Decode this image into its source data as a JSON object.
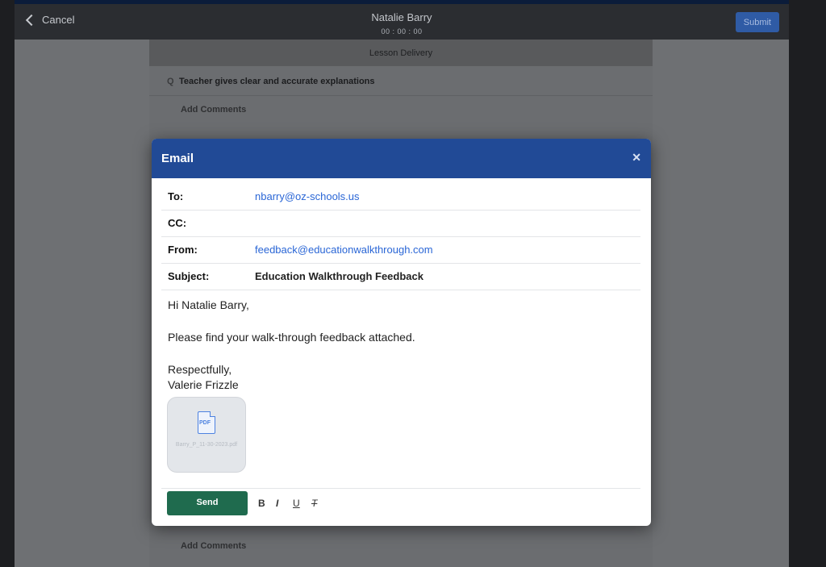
{
  "topbar": {
    "cancel_label": "Cancel",
    "title": "Natalie Barry",
    "timer": "00 : 00 : 00",
    "submit_label": "Submit"
  },
  "background": {
    "section_title": "Lesson Delivery",
    "question_marker": "Q",
    "question_text": "Teacher gives clear and accurate explanations",
    "add_comments_label": "Add Comments"
  },
  "modal": {
    "title": "Email",
    "close_icon": "close-icon",
    "fields": {
      "to_label": "To:",
      "to_value": "nbarry@oz-schools.us",
      "cc_label": "CC:",
      "cc_value": "",
      "from_label": "From:",
      "from_value": "feedback@educationwalkthrough.com",
      "subject_label": "Subject:",
      "subject_value": "Education Walkthrough Feedback"
    },
    "body": {
      "greeting": "Hi Natalie Barry,",
      "message": "Please find your walk-through feedback attached.",
      "closing": "Respectfully,",
      "signature": "Valerie Frizzle"
    },
    "attachment": {
      "icon": "pdf-file-icon",
      "icon_text": "PDF",
      "name": "Barry_P_11-30-2023.pdf"
    },
    "toolbar": {
      "send_label": "Send",
      "bold_label": "B",
      "italic_label": "I",
      "underline_label": "U",
      "clear_format_label": "T"
    }
  },
  "colors": {
    "modal_header": "#214a96",
    "send_button": "#1f6b4e",
    "link": "#2a66d6"
  }
}
